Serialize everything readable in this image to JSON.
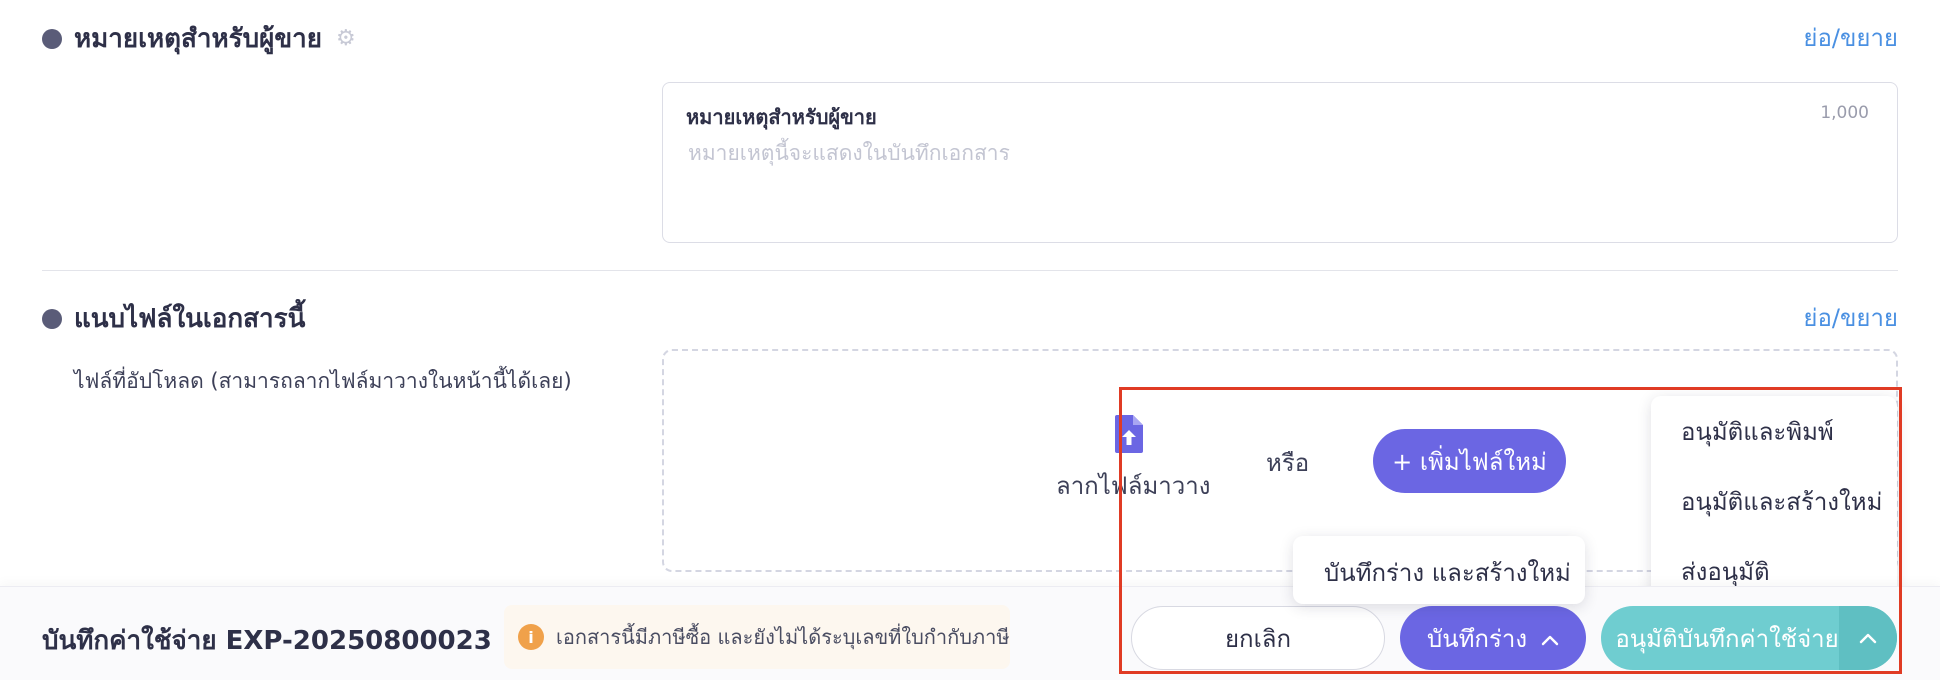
{
  "seller_notes": {
    "title": "หมายเหตุสำหรับผู้ขาย",
    "toggle_label": "ย่อ/ขยาย",
    "field_label": "หมายเหตุสำหรับผู้ขาย",
    "placeholder": "หมายเหตุนี้จะแสดงในบันทึกเอกสาร",
    "char_limit": "1,000"
  },
  "attachments": {
    "title": "แนบไฟล์ในเอกสารนี้",
    "toggle_label": "ย่อ/ขยาย",
    "description": "ไฟล์ที่อัปโหลด (สามารถลากไฟล์มาวางในหน้านี้ได้เลย)",
    "drag_text": "ลากไฟล์มาวาง",
    "or_text": "หรือ",
    "add_file_label": "+ เพิ่มไฟล์ใหม่"
  },
  "draft_menu": {
    "items": [
      "บันทึกร่าง และสร้างใหม่"
    ]
  },
  "approve_menu": {
    "items": [
      "อนุมัติและพิมพ์",
      "อนุมัติและสร้างใหม่",
      "ส่งอนุมัติ"
    ]
  },
  "footer": {
    "doc_title": "บันทึกค่าใช้จ่าย EXP-20250800023",
    "warning_text": "เอกสารนี้มีภาษีซื้อ และยังไม่ได้ระบุเลขที่ใบกำกับภาษี",
    "warning_icon": "info-icon",
    "cancel_label": "ยกเลิก",
    "draft_label": "บันทึกร่าง",
    "approve_label": "อนุมัติบันทึกค่าใช้จ่าย"
  },
  "colors": {
    "primary": "#6b66e3",
    "approve": "#6fcdd0",
    "link": "#4a90e2",
    "warning": "#f0a14a",
    "highlight": "#e03b24"
  }
}
